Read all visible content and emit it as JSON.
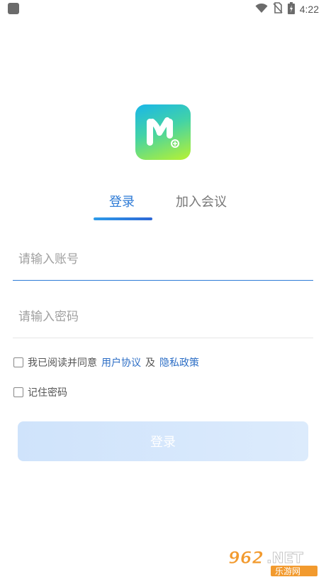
{
  "status_bar": {
    "time": "4:22",
    "icons": [
      "wifi-icon",
      "no-sim-icon",
      "battery-charging-icon"
    ]
  },
  "logo": {
    "glyph": "M"
  },
  "tabs": [
    {
      "label": "登录",
      "active": true
    },
    {
      "label": "加入会议",
      "active": false
    }
  ],
  "form": {
    "account_placeholder": "请输入账号",
    "account_value": "",
    "password_placeholder": "请输入密码",
    "password_value": ""
  },
  "agreement": {
    "prefix": "我已阅读并同意",
    "user_agreement": "用户协议",
    "and": "及",
    "privacy_policy": "隐私政策",
    "checked": false
  },
  "remember": {
    "label": "记住密码",
    "checked": false
  },
  "login_button": {
    "label": "登录"
  },
  "watermark": {
    "text": "962.NET",
    "subtext": "乐游网"
  },
  "colors": {
    "accent": "#2e7bd6",
    "button_bg": "#d4e6fb"
  }
}
